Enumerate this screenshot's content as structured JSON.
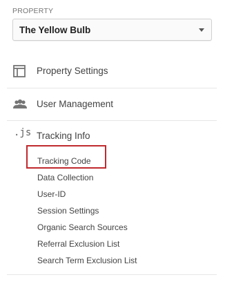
{
  "property": {
    "section_label": "PROPERTY",
    "selected_value": "The Yellow Bulb"
  },
  "menu": {
    "items": [
      {
        "icon": "layout-panel-icon",
        "label": "Property Settings"
      },
      {
        "icon": "people-icon",
        "label": "User Management"
      },
      {
        "icon": "js-icon",
        "icon_text": ".js",
        "label": "Tracking Info"
      }
    ]
  },
  "tracking_info": {
    "sub_items": [
      "Tracking Code",
      "Data Collection",
      "User-ID",
      "Session Settings",
      "Organic Search Sources",
      "Referral Exclusion List",
      "Search Term Exclusion List"
    ],
    "highlighted": "Tracking Code"
  },
  "colors": {
    "highlight_border": "#c0282d",
    "icon": "#757575",
    "text": "#424242"
  }
}
